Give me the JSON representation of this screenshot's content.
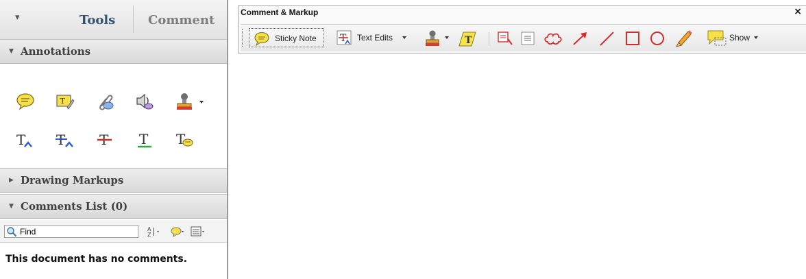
{
  "panel": {
    "tabs": {
      "menu_glyph": "▾",
      "tools": "Tools",
      "comment": "Comment"
    },
    "sections": {
      "annotations": "Annotations",
      "drawing_markups": "Drawing Markups",
      "comments_list": "Comments List (0)"
    },
    "annotation_tools": {
      "row1": [
        "sticky-note-icon",
        "text-box-icon",
        "attach-file-icon",
        "record-audio-icon",
        "stamp-icon"
      ],
      "row2": [
        "insert-text-icon",
        "replace-text-icon",
        "strikethrough-icon",
        "underline-icon",
        "text-comment-icon"
      ]
    },
    "find": {
      "value": "Find"
    },
    "empty_message": "This document has no comments."
  },
  "toolbar": {
    "title": "Comment & Markup",
    "close": "×",
    "sticky_note": "Sticky Note",
    "text_edits": "Text Edits",
    "show": "Show"
  },
  "colors": {
    "tools_tab": "#34526e",
    "comment_tab": "#7d7d7d",
    "markup_red": "#d52b2b",
    "note_yellow": "#f7e04a"
  }
}
